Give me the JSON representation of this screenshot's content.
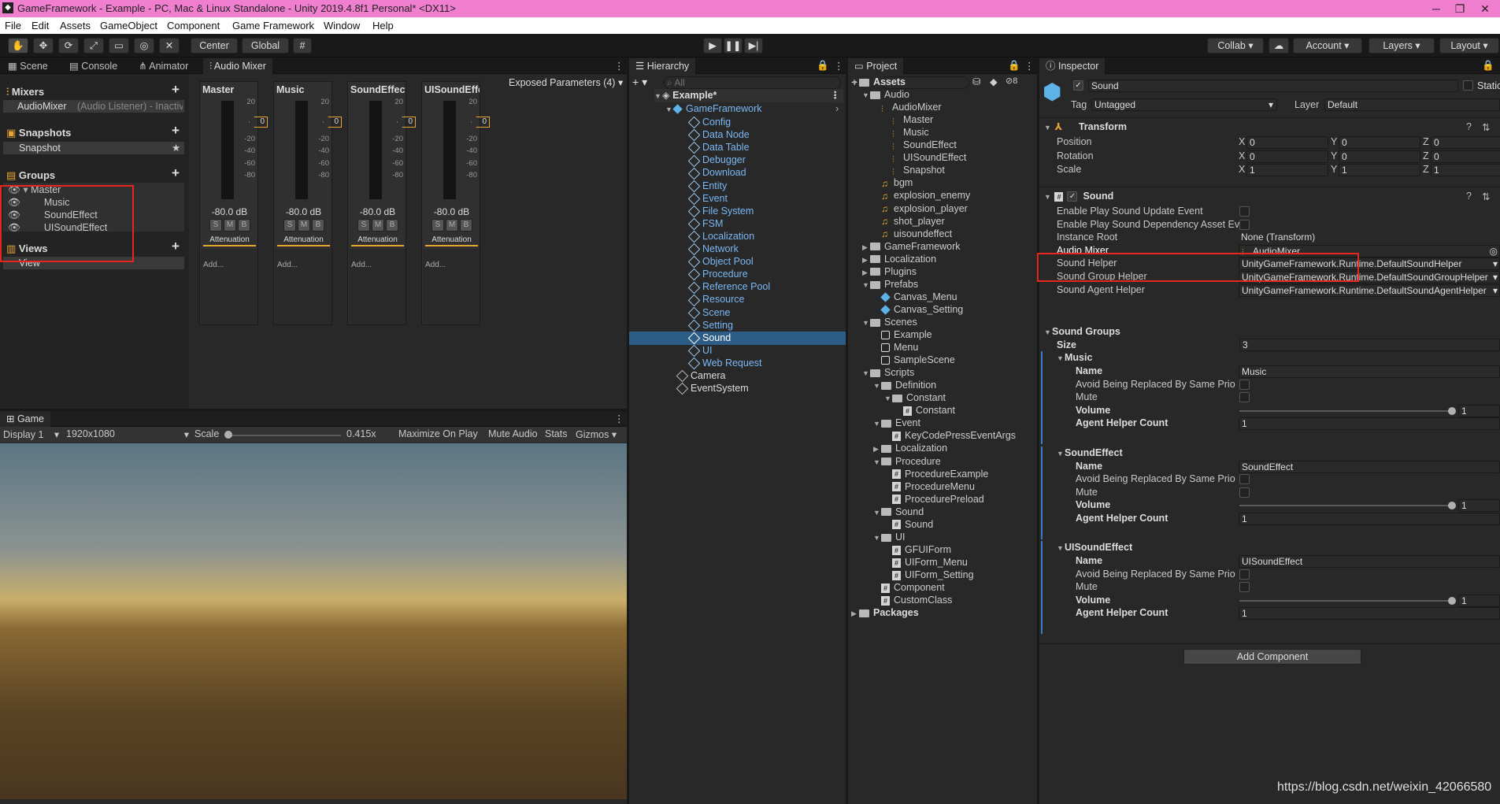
{
  "titlebar": {
    "title": "GameFramework - Example - PC, Mac & Linux Standalone - Unity 2019.4.8f1 Personal* <DX11>"
  },
  "menubar": [
    "File",
    "Edit",
    "Assets",
    "GameObject",
    "Component",
    "Game Framework",
    "Window",
    "Help"
  ],
  "toolbar": {
    "center": "Center",
    "global": "Global",
    "collab": "Collab",
    "account": "Account",
    "layers": "Layers",
    "layout": "Layout"
  },
  "scene_panel": {
    "tabs": [
      "Scene",
      "Console",
      "Animator",
      "Audio Mixer"
    ],
    "exposed_params": "Exposed Parameters (4)",
    "mixers_title": "Mixers",
    "mixer_item": "AudioMixer",
    "mixer_item_sub": "(Audio Listener) - Inactiv",
    "snapshots_title": "Snapshots",
    "snapshot_item": "Snapshot",
    "groups_title": "Groups",
    "groups": [
      "Master",
      "Music",
      "SoundEffect",
      "UISoundEffect"
    ],
    "views_title": "Views",
    "view_item": "View",
    "strips": [
      {
        "name": "Master",
        "db": "-80.0 dB",
        "level": "0"
      },
      {
        "name": "Music",
        "db": "-80.0 dB",
        "level": "0"
      },
      {
        "name": "SoundEffect",
        "db": "-80.0 dB",
        "level": "0"
      },
      {
        "name": "UISoundEffect",
        "db": "-80.0 dB",
        "level": "0"
      }
    ],
    "strip_ticks": [
      "20",
      "0",
      "-20",
      "-40",
      "-60",
      "-80"
    ],
    "strip_buttons": [
      "S",
      "M",
      "B"
    ],
    "attenuation": "Attenuation",
    "add": "Add..."
  },
  "game_panel": {
    "tab": "Game",
    "display": "Display 1",
    "resolution": "1920x1080",
    "scale_label": "Scale",
    "scale_value": "0.415x",
    "maximize": "Maximize On Play",
    "mute": "Mute Audio",
    "stats": "Stats",
    "gizmos": "Gizmos"
  },
  "hierarchy": {
    "tab": "Hierarchy",
    "search_placeholder": "All",
    "scene": "Example*",
    "root": "GameFramework",
    "children": [
      "Config",
      "Data Node",
      "Data Table",
      "Debugger",
      "Download",
      "Entity",
      "Event",
      "File System",
      "FSM",
      "Localization",
      "Network",
      "Object Pool",
      "Procedure",
      "Reference Pool",
      "Resource",
      "Scene",
      "Setting",
      "Sound",
      "UI",
      "Web Request"
    ],
    "selected": "Sound",
    "others": [
      "Camera",
      "EventSystem"
    ]
  },
  "project": {
    "tab": "Project",
    "count": "8",
    "items": [
      {
        "d": 0,
        "k": "folder",
        "t": "Assets",
        "open": true
      },
      {
        "d": 1,
        "k": "folder",
        "t": "Audio",
        "open": true
      },
      {
        "d": 2,
        "k": "mixer",
        "t": "AudioMixer",
        "open": true
      },
      {
        "d": 3,
        "k": "mixer",
        "t": "Master"
      },
      {
        "d": 3,
        "k": "mixer",
        "t": "Music"
      },
      {
        "d": 3,
        "k": "mixer",
        "t": "SoundEffect"
      },
      {
        "d": 3,
        "k": "mixer",
        "t": "UISoundEffect"
      },
      {
        "d": 3,
        "k": "mixer",
        "t": "Snapshot"
      },
      {
        "d": 2,
        "k": "audio",
        "t": "bgm"
      },
      {
        "d": 2,
        "k": "audio",
        "t": "explosion_enemy"
      },
      {
        "d": 2,
        "k": "audio",
        "t": "explosion_player"
      },
      {
        "d": 2,
        "k": "audio",
        "t": "shot_player"
      },
      {
        "d": 2,
        "k": "audio",
        "t": "uisoundeffect"
      },
      {
        "d": 1,
        "k": "folder",
        "t": "GameFramework",
        "open": false
      },
      {
        "d": 1,
        "k": "folder",
        "t": "Localization",
        "open": false
      },
      {
        "d": 1,
        "k": "folder",
        "t": "Plugins",
        "open": false
      },
      {
        "d": 1,
        "k": "folder",
        "t": "Prefabs",
        "open": true
      },
      {
        "d": 2,
        "k": "prefab",
        "t": "Canvas_Menu"
      },
      {
        "d": 2,
        "k": "prefab",
        "t": "Canvas_Setting"
      },
      {
        "d": 1,
        "k": "folder",
        "t": "Scenes",
        "open": true
      },
      {
        "d": 2,
        "k": "scene",
        "t": "Example"
      },
      {
        "d": 2,
        "k": "scene",
        "t": "Menu"
      },
      {
        "d": 2,
        "k": "scene",
        "t": "SampleScene"
      },
      {
        "d": 1,
        "k": "folder",
        "t": "Scripts",
        "open": true
      },
      {
        "d": 2,
        "k": "folder",
        "t": "Definition",
        "open": true
      },
      {
        "d": 3,
        "k": "folder",
        "t": "Constant",
        "open": true
      },
      {
        "d": 4,
        "k": "script",
        "t": "Constant"
      },
      {
        "d": 2,
        "k": "folder",
        "t": "Event",
        "open": true
      },
      {
        "d": 3,
        "k": "script",
        "t": "KeyCodePressEventArgs"
      },
      {
        "d": 2,
        "k": "folder",
        "t": "Localization",
        "open": false
      },
      {
        "d": 2,
        "k": "folder",
        "t": "Procedure",
        "open": true
      },
      {
        "d": 3,
        "k": "script",
        "t": "ProcedureExample"
      },
      {
        "d": 3,
        "k": "script",
        "t": "ProcedureMenu"
      },
      {
        "d": 3,
        "k": "script",
        "t": "ProcedurePreload"
      },
      {
        "d": 2,
        "k": "folder",
        "t": "Sound",
        "open": true
      },
      {
        "d": 3,
        "k": "script",
        "t": "Sound"
      },
      {
        "d": 2,
        "k": "folder",
        "t": "UI",
        "open": true
      },
      {
        "d": 3,
        "k": "script",
        "t": "GFUIForm"
      },
      {
        "d": 3,
        "k": "script",
        "t": "UIForm_Menu"
      },
      {
        "d": 3,
        "k": "script",
        "t": "UIForm_Setting"
      },
      {
        "d": 2,
        "k": "script",
        "t": "Component"
      },
      {
        "d": 2,
        "k": "script",
        "t": "CustomClass"
      },
      {
        "d": 0,
        "k": "folder",
        "t": "Packages",
        "open": false
      }
    ]
  },
  "inspector": {
    "tab": "Inspector",
    "object_name": "Sound",
    "static_label": "Static",
    "tag_label": "Tag",
    "tag_value": "Untagged",
    "layer_label": "Layer",
    "layer_value": "Default",
    "transform": {
      "title": "Transform",
      "rows": [
        {
          "label": "Position",
          "x": "0",
          "y": "0",
          "z": "0"
        },
        {
          "label": "Rotation",
          "x": "0",
          "y": "0",
          "z": "0"
        },
        {
          "label": "Scale",
          "x": "1",
          "y": "1",
          "z": "1"
        }
      ],
      "axis": [
        "X",
        "Y",
        "Z"
      ]
    },
    "sound_component": {
      "title": "Sound",
      "fields": [
        {
          "label": "Enable Play Sound Update Event",
          "value": "",
          "kind": "check"
        },
        {
          "label": "Enable Play Sound Dependency Asset Ev",
          "value": "",
          "kind": "check"
        },
        {
          "label": "Instance Root",
          "value": "None (Transform)",
          "kind": "text"
        },
        {
          "label": "Audio Mixer",
          "value": "AudioMixer",
          "kind": "object"
        },
        {
          "label": "Sound Helper",
          "value": "UnityGameFramework.Runtime.DefaultSoundHelper",
          "kind": "dropdown"
        },
        {
          "label": "Sound Group Helper",
          "value": "UnityGameFramework.Runtime.DefaultSoundGroupHelper",
          "kind": "dropdown"
        },
        {
          "label": "Sound Agent Helper",
          "value": "UnityGameFramework.Runtime.DefaultSoundAgentHelper",
          "kind": "dropdown"
        }
      ],
      "groups_title": "Sound Groups",
      "size_label": "Size",
      "size_value": "3",
      "groups": [
        {
          "title": "Music",
          "name": "Music",
          "volume": "1",
          "agents": "1"
        },
        {
          "title": "SoundEffect",
          "name": "SoundEffect",
          "volume": "1",
          "agents": "1"
        },
        {
          "title": "UISoundEffect",
          "name": "UISoundEffect",
          "volume": "1",
          "agents": "1"
        }
      ],
      "labels": {
        "name": "Name",
        "avoid": "Avoid Being Replaced By Same Prio",
        "mute": "Mute",
        "volume": "Volume",
        "agents": "Agent Helper Count"
      }
    },
    "add_component": "Add Component"
  },
  "watermark": "https://blog.csdn.net/weixin_42066580"
}
